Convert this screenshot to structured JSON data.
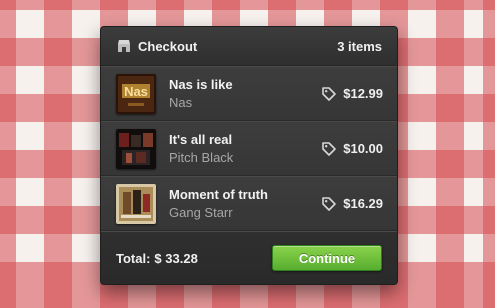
{
  "header": {
    "title": "Checkout",
    "count": "3 items",
    "icon": "shop-icon"
  },
  "items": [
    {
      "title": "Nas is like",
      "artist": "Nas",
      "price": "$12.99",
      "cover_text": "Nas"
    },
    {
      "title": "It's all real",
      "artist": "Pitch Black",
      "price": "$10.00",
      "cover_text": ""
    },
    {
      "title": "Moment of truth",
      "artist": "Gang Starr",
      "price": "$16.29",
      "cover_text": ""
    }
  ],
  "footer": {
    "total_label": "Total:",
    "total_value": "$ 33.28",
    "continue_label": "Continue"
  },
  "colors": {
    "panel_bg": "#3a3a3a",
    "accent_green": "#57ad2f",
    "tablecloth_red": "#d64c52"
  }
}
